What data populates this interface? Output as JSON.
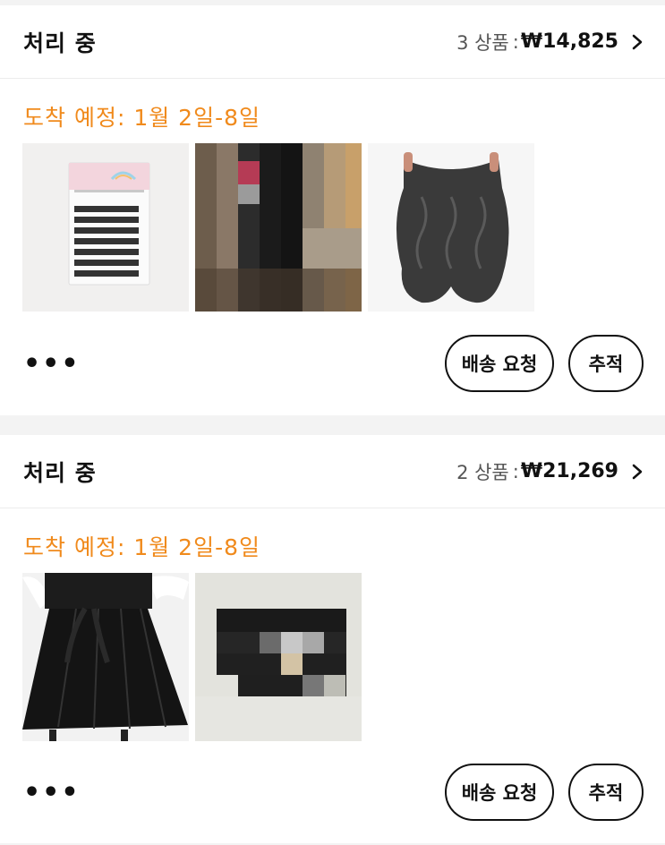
{
  "orders": [
    {
      "status": "처리 중",
      "item_count": "3 상품",
      "separator": ":",
      "total": "₩14,825",
      "eta": "도착 예정: 1월 2일-8일",
      "more": "•••",
      "request_label": "배송 요청",
      "track_label": "추적",
      "thumbnails": [
        "eyelash-extensions",
        "pixelated-item",
        "wavy-hair-extension"
      ]
    },
    {
      "status": "처리 중",
      "item_count": "2 상품",
      "separator": ":",
      "total": "₩21,269",
      "eta": "도착 예정: 1월 2일-8일",
      "more": "•••",
      "request_label": "배송 요청",
      "track_label": "추적",
      "thumbnails": [
        "black-maxi-skirt",
        "pixelated-item"
      ]
    }
  ],
  "colors": {
    "accent": "#f08a1c",
    "text": "#111111",
    "muted": "#555555",
    "divider": "#f3f3f3"
  },
  "icons": {
    "chevron": "chevron-right-icon"
  }
}
